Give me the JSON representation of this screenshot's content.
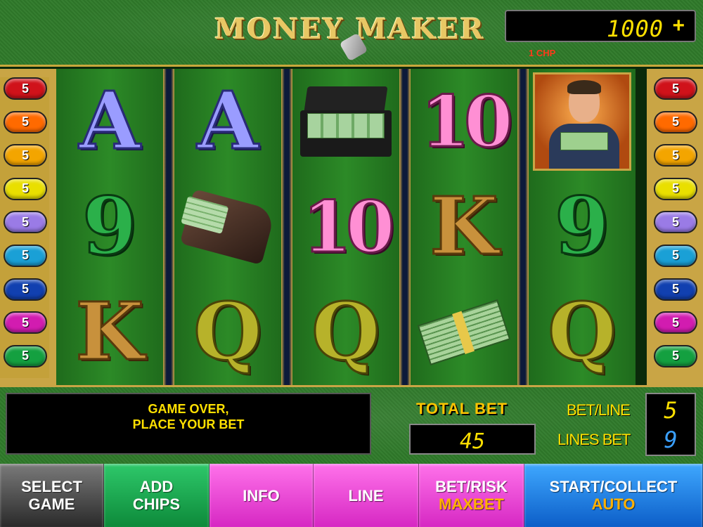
{
  "header": {
    "logo_text": "MONEY MAKER",
    "credit": "1000",
    "credit_plus": "+",
    "chip_denomination": "1 CHP"
  },
  "lines_left": [
    "5",
    "5",
    "5",
    "5",
    "5",
    "5",
    "5",
    "5",
    "5"
  ],
  "lines_right": [
    "5",
    "5",
    "5",
    "5",
    "5",
    "5",
    "5",
    "5",
    "5"
  ],
  "line_colors": [
    "#d0121a",
    "#ff6a00",
    "#f3a500",
    "#e9df00",
    "#9a7be6",
    "#1aa0d6",
    "#1140b0",
    "#d21cb0",
    "#14a040"
  ],
  "reels": [
    [
      "A",
      "9",
      "K"
    ],
    [
      "A",
      "wallet",
      "Q"
    ],
    [
      "briefcase",
      "10",
      "Q"
    ],
    [
      "10",
      "K",
      "cash-stack"
    ],
    [
      "money-man",
      "9",
      "Q"
    ]
  ],
  "message": "GAME OVER,\nPLACE YOUR BET",
  "total_bet_label": "TOTAL BET",
  "total_bet": "45",
  "bet_line_label": "BET/LINE",
  "bet_line": "5",
  "lines_bet_label": "LINES BET",
  "lines_bet": "9",
  "buttons": {
    "select": "SELECT\nGAME",
    "add": "ADD\nCHIPS",
    "info": "INFO",
    "line": "LINE",
    "betrisk": "BET/RISK",
    "betrisk_sub": "MAXBET",
    "start": "START/COLLECT",
    "start_sub": "AUTO"
  }
}
